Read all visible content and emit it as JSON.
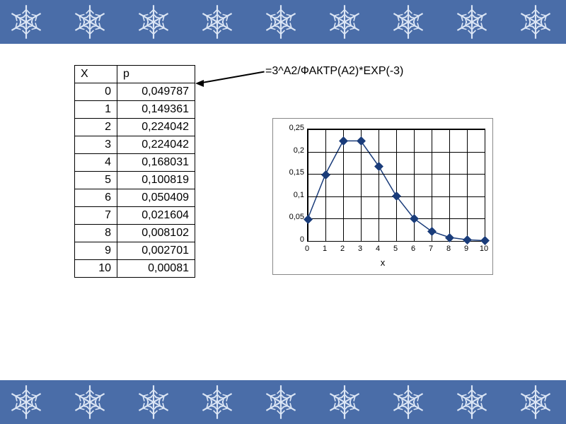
{
  "table": {
    "headers": [
      "X",
      "p"
    ],
    "rows": [
      {
        "x": "0",
        "p": "0,049787"
      },
      {
        "x": "1",
        "p": "0,149361"
      },
      {
        "x": "2",
        "p": "0,224042"
      },
      {
        "x": "3",
        "p": "0,224042"
      },
      {
        "x": "4",
        "p": "0,168031"
      },
      {
        "x": "5",
        "p": "0,100819"
      },
      {
        "x": "6",
        "p": "0,050409"
      },
      {
        "x": "7",
        "p": "0,021604"
      },
      {
        "x": "8",
        "p": "0,008102"
      },
      {
        "x": "9",
        "p": "0,002701"
      },
      {
        "x": "10",
        "p": "0,00081"
      }
    ]
  },
  "formula": "=3^A2/ФАКТР(A2)*EXP(-3)",
  "chart_data": {
    "type": "line",
    "x": [
      0,
      1,
      2,
      3,
      4,
      5,
      6,
      7,
      8,
      9,
      10
    ],
    "values": [
      0.049787,
      0.149361,
      0.224042,
      0.224042,
      0.168031,
      0.100819,
      0.050409,
      0.021604,
      0.008102,
      0.002701,
      0.00081
    ],
    "xlabel": "x",
    "ylabel": "",
    "xlim": [
      0,
      10
    ],
    "ylim": [
      0,
      0.25
    ],
    "yticks": [
      0,
      0.05,
      0.1,
      0.15,
      0.2,
      0.25
    ],
    "ytick_labels": [
      "0",
      "0,05",
      "0,1",
      "0,15",
      "0,2",
      "0,25"
    ],
    "xticks": [
      0,
      1,
      2,
      3,
      4,
      5,
      6,
      7,
      8,
      9,
      10
    ],
    "xtick_labels": [
      "0",
      "1",
      "2",
      "3",
      "4",
      "5",
      "6",
      "7",
      "8",
      "9",
      "10"
    ],
    "marker": "diamond",
    "line_color": "#1a3c7a"
  },
  "decor": {
    "band_color": "#4a6da8"
  }
}
